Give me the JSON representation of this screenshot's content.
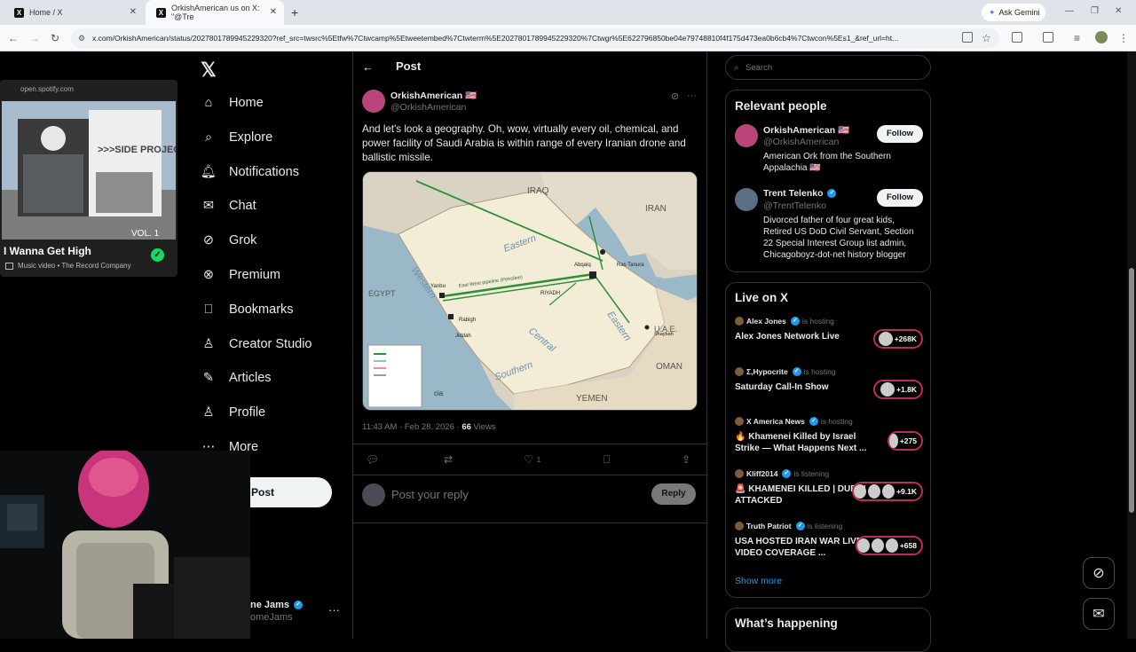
{
  "browser": {
    "tabs": [
      {
        "title": "Home / X"
      },
      {
        "title": "OrkishAmerican us on X: \"@Tre"
      }
    ],
    "ask_gemini": "Ask Gemini",
    "url": "x.com/OrkishAmerican/status/2027801789945229320?ref_src=twsrc%5Etfw%7Ctwcamp%5Etweetembed%7Ctwterm%5E2027801789945229320%7Ctwgr%5E622796850be04e79748810f4f175d473ea0b6cb4%7Ctwcon%5Es1_&ref_url=ht..."
  },
  "spotify": {
    "source": "open.spotify.com",
    "title": "I Wanna Get High",
    "subtitle": "Music video • The Record Company",
    "cover_text": ">>>SIDE PROJECT",
    "cover_vol": "VOL. 1"
  },
  "nav": {
    "items": [
      {
        "label": "Home",
        "icon": "home-icon"
      },
      {
        "label": "Explore",
        "icon": "search-icon"
      },
      {
        "label": "Notifications",
        "icon": "bell-icon"
      },
      {
        "label": "Chat",
        "icon": "mail-icon"
      },
      {
        "label": "Grok",
        "icon": "grok-icon"
      },
      {
        "label": "Premium",
        "icon": "premium-icon"
      },
      {
        "label": "Bookmarks",
        "icon": "bookmark-icon"
      },
      {
        "label": "Creator Studio",
        "icon": "creator-icon"
      },
      {
        "label": "Articles",
        "icon": "article-icon"
      },
      {
        "label": "Profile",
        "icon": "person-icon"
      },
      {
        "label": "More",
        "icon": "more-circle-icon"
      }
    ],
    "post_button": "Post",
    "account_name": "ne Jams",
    "account_handle": "omeJams"
  },
  "post": {
    "header": "Post",
    "author_name": "OrkishAmerican 🇺🇸",
    "author_handle": "@OrkishAmerican",
    "text": "And let's look a geography. Oh, wow, virtually every oil, chemical, and power facility of Saudi Arabia is within range of every Iranian drone and ballistic missile.",
    "timestamp": "11:43 AM · Feb 28, 2026 ·",
    "views_count": "66",
    "views_label": "Views",
    "likes": "1",
    "reply_placeholder": "Post your reply",
    "reply_button": "Reply",
    "map_labels": {
      "iraq": "IRAQ",
      "iran": "IRAN",
      "egypt": "EGYPT",
      "uae": "U.A.E.",
      "oman": "OMAN",
      "yemen": "YEMEN",
      "western": "Western",
      "central": "Central",
      "eastern": "Eastern",
      "eastern2": "Eastern",
      "southern": "Southern",
      "riyadh": "RIYADH",
      "yanbu": "Yanbu",
      "rabigh": "Rabigh",
      "jiddah": "Jiddah",
      "ras_tanura": "Ras Tanura",
      "abqaiq": "Abqaiq",
      "shaybah": "Shaybah",
      "pipeline": "East-West pipeline (Petroline)",
      "cia": "cia"
    }
  },
  "right": {
    "search_placeholder": "Search",
    "relevant_title": "Relevant people",
    "people": [
      {
        "name": "OrkishAmerican 🇺🇸",
        "handle": "@OrkishAmerican",
        "bio": "American Ork from the Southern Appalachia 🇺🇸",
        "follow": "Follow",
        "color": "#b9457c"
      },
      {
        "name": "Trent Telenko",
        "handle": "@TrentTelenko",
        "bio": "Divorced father of four great kids, Retired US DoD Civil Servant, Section 22 Special Interest Group list admin, Chicagoboyz-dot-net history blogger",
        "follow": "Follow",
        "color": "#5a6e84"
      }
    ],
    "live_title": "Live on X",
    "live": [
      {
        "host": "Alex Jones",
        "status": "is hosting",
        "title": "Alex Jones Network Live",
        "count": "+268K"
      },
      {
        "host": "Σ,Hypocrite",
        "status": "is hosting",
        "title": "Saturday Call-In Show",
        "count": "+1.8K"
      },
      {
        "host": "X America News",
        "status": "is hosting",
        "title": "🔥 Khamenei Killed by Israel Strike — What Happens Next ...",
        "count": "+275"
      },
      {
        "host": "Kliff2014",
        "status": "is listening",
        "title": "🚨 KHAMENEI KILLED | DUBAI ATTACKED",
        "count": "+9.1K"
      },
      {
        "host": "Truth Patriot",
        "status": "is listening",
        "title": "USA HOSTED IRAN WAR LIVE VIDEO COVERAGE ...",
        "count": "+658"
      }
    ],
    "show_more": "Show more",
    "happening_title": "What’s happening"
  }
}
